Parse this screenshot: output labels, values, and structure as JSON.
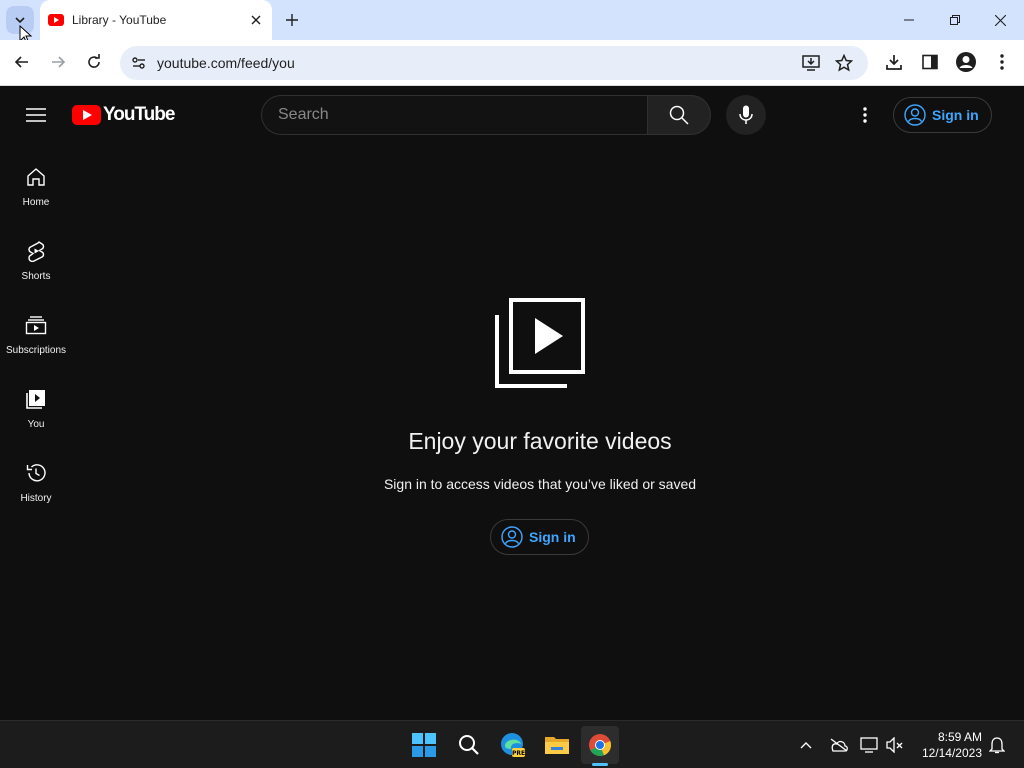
{
  "browser": {
    "tab_title": "Library - YouTube",
    "url": "youtube.com/feed/you"
  },
  "youtube": {
    "logo_text": "YouTube",
    "search_placeholder": "Search",
    "signin_label": "Sign in",
    "sidebar": [
      {
        "label": "Home",
        "icon": "home-icon"
      },
      {
        "label": "Shorts",
        "icon": "shorts-icon"
      },
      {
        "label": "Subscriptions",
        "icon": "subscriptions-icon"
      },
      {
        "label": "You",
        "icon": "you-icon"
      },
      {
        "label": "History",
        "icon": "history-icon"
      }
    ],
    "empty_state": {
      "title": "Enjoy your favorite videos",
      "subtitle": "Sign in to access videos that you’ve liked or saved",
      "signin_label": "Sign in"
    }
  },
  "taskbar": {
    "time": "8:59 AM",
    "date": "12/14/2023"
  },
  "colors": {
    "yt_background": "#0f0f0f",
    "yt_red": "#ff0000",
    "link_blue": "#3ea6ff",
    "tabstrip": "#d3e3fd"
  }
}
